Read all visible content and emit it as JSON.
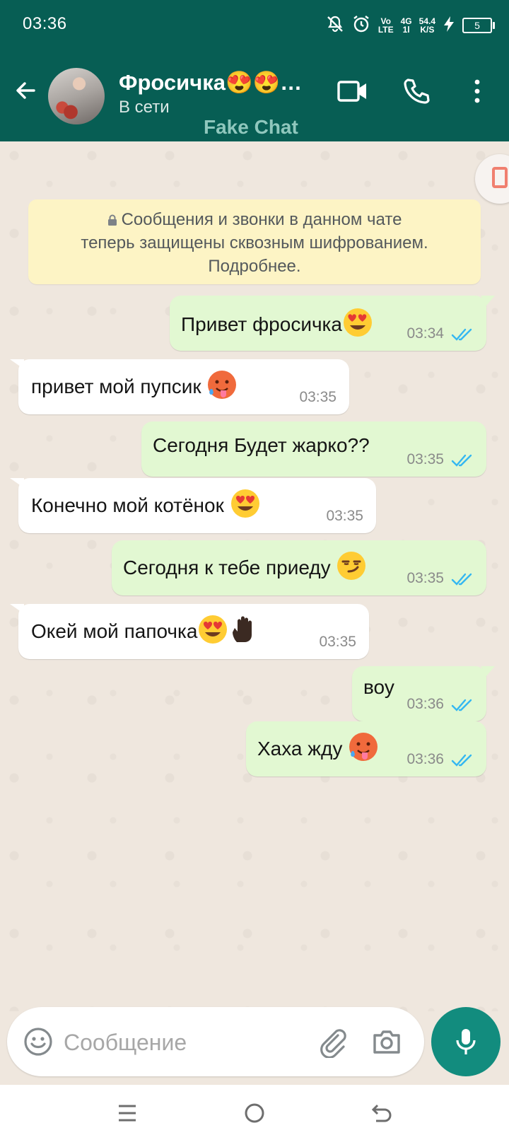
{
  "status_bar": {
    "time": "03:36",
    "volte_top": "Vo",
    "volte_bottom": "LTE",
    "network_top": "4G",
    "network_bottom": "1l",
    "speed_top": "54.4",
    "speed_bottom": "K/S",
    "battery": "5"
  },
  "header": {
    "contact_name": "Фросичка😍😍…",
    "contact_status": "В сети",
    "watermark": "Fake Chat",
    "colors": {
      "bar": "#075e54",
      "accent": "#128c7e"
    }
  },
  "encryption_notice": {
    "line1": "Сообщения и звонки в данном чате",
    "line2": "теперь защищены сквозным шифрованием.",
    "line3": "Подробнее."
  },
  "messages": [
    {
      "direction": "out",
      "text": "Привет фросичка",
      "emoji": "heart-eyes",
      "time": "03:34",
      "status": "read"
    },
    {
      "direction": "in",
      "text": "привет мой пупсик ",
      "emoji": "hot-face",
      "time": "03:35"
    },
    {
      "direction": "out",
      "text": "Сегодня Будет жарко??",
      "emoji": "",
      "time": "03:35",
      "status": "read"
    },
    {
      "direction": "in",
      "text": "Конечно мой котёнок ",
      "emoji": "heart-eyes",
      "time": "03:35"
    },
    {
      "direction": "out",
      "text": "Сегодня к тебе приеду ",
      "emoji": "smirk",
      "time": "03:35",
      "status": "read"
    },
    {
      "direction": "in",
      "text": "Окей мой папочка",
      "emoji": "heart-eyes+raised-hand",
      "time": "03:35"
    },
    {
      "direction": "out",
      "text": "воу",
      "emoji": "",
      "time": "03:36",
      "status": "read"
    },
    {
      "direction": "out",
      "text": "Хаха жду ",
      "emoji": "hot-face",
      "time": "03:36",
      "status": "read"
    }
  ],
  "composer": {
    "placeholder": "Сообщение"
  }
}
